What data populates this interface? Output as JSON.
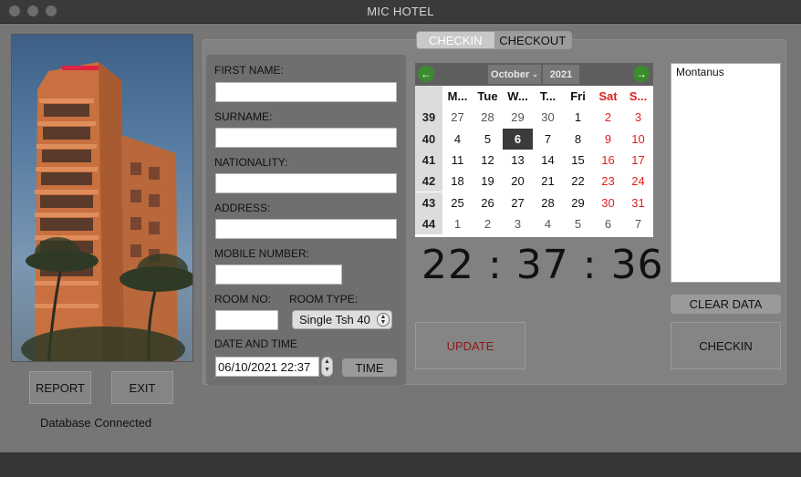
{
  "window": {
    "title": "MIC HOTEL"
  },
  "left": {
    "report_label": "REPORT",
    "exit_label": "EXIT",
    "status": "Database Connected"
  },
  "tabs": [
    {
      "label": "CHECKIN",
      "active": true
    },
    {
      "label": "CHECKOUT",
      "active": false
    }
  ],
  "form": {
    "first_name_label": "FIRST NAME:",
    "first_name_value": "",
    "surname_label": "SURNAME:",
    "surname_value": "",
    "nationality_label": "NATIONALITY:",
    "nationality_value": "",
    "address_label": "ADDRESS:",
    "address_value": "",
    "mobile_label": "MOBILE NUMBER:",
    "mobile_value": "",
    "room_no_label": "ROOM NO:",
    "room_no_value": "",
    "room_type_label": "ROOM TYPE:",
    "room_type_value": "Single Tsh 40",
    "datetime_label": "DATE AND TIME",
    "datetime_value": "06/10/2021 22:37",
    "time_button": "TIME"
  },
  "calendar": {
    "month": "October",
    "year": "2021",
    "headers": [
      "M...",
      "Tue",
      "W...",
      "T...",
      "Fri",
      "Sat",
      "S..."
    ],
    "weeks": [
      {
        "week": "39",
        "days": [
          "27",
          "28",
          "29",
          "30",
          "1",
          "2",
          "3"
        ]
      },
      {
        "week": "40",
        "days": [
          "4",
          "5",
          "6",
          "7",
          "8",
          "9",
          "10"
        ]
      },
      {
        "week": "41",
        "days": [
          "11",
          "12",
          "13",
          "14",
          "15",
          "16",
          "17"
        ]
      },
      {
        "week": "42",
        "days": [
          "18",
          "19",
          "20",
          "21",
          "22",
          "23",
          "24"
        ]
      },
      {
        "week": "43",
        "days": [
          "25",
          "26",
          "27",
          "28",
          "29",
          "30",
          "31"
        ]
      },
      {
        "week": "44",
        "days": [
          "1",
          "2",
          "3",
          "4",
          "5",
          "6",
          "7"
        ]
      }
    ],
    "selected_day": "6",
    "weekend_color": "#e02020"
  },
  "clock": {
    "display": "22 : 37 : 36"
  },
  "list": {
    "items": [
      "Montanus"
    ]
  },
  "buttons": {
    "clear_data": "CLEAR DATA",
    "update": "UPDATE",
    "checkin": "CHECKIN"
  },
  "icons": {
    "prev": "arrow-left-icon",
    "next": "arrow-right-icon",
    "month_dropdown": "chevron-down-icon"
  },
  "colors": {
    "update_text": "#8b1a1a",
    "nav_green": "#3c8a2e"
  }
}
